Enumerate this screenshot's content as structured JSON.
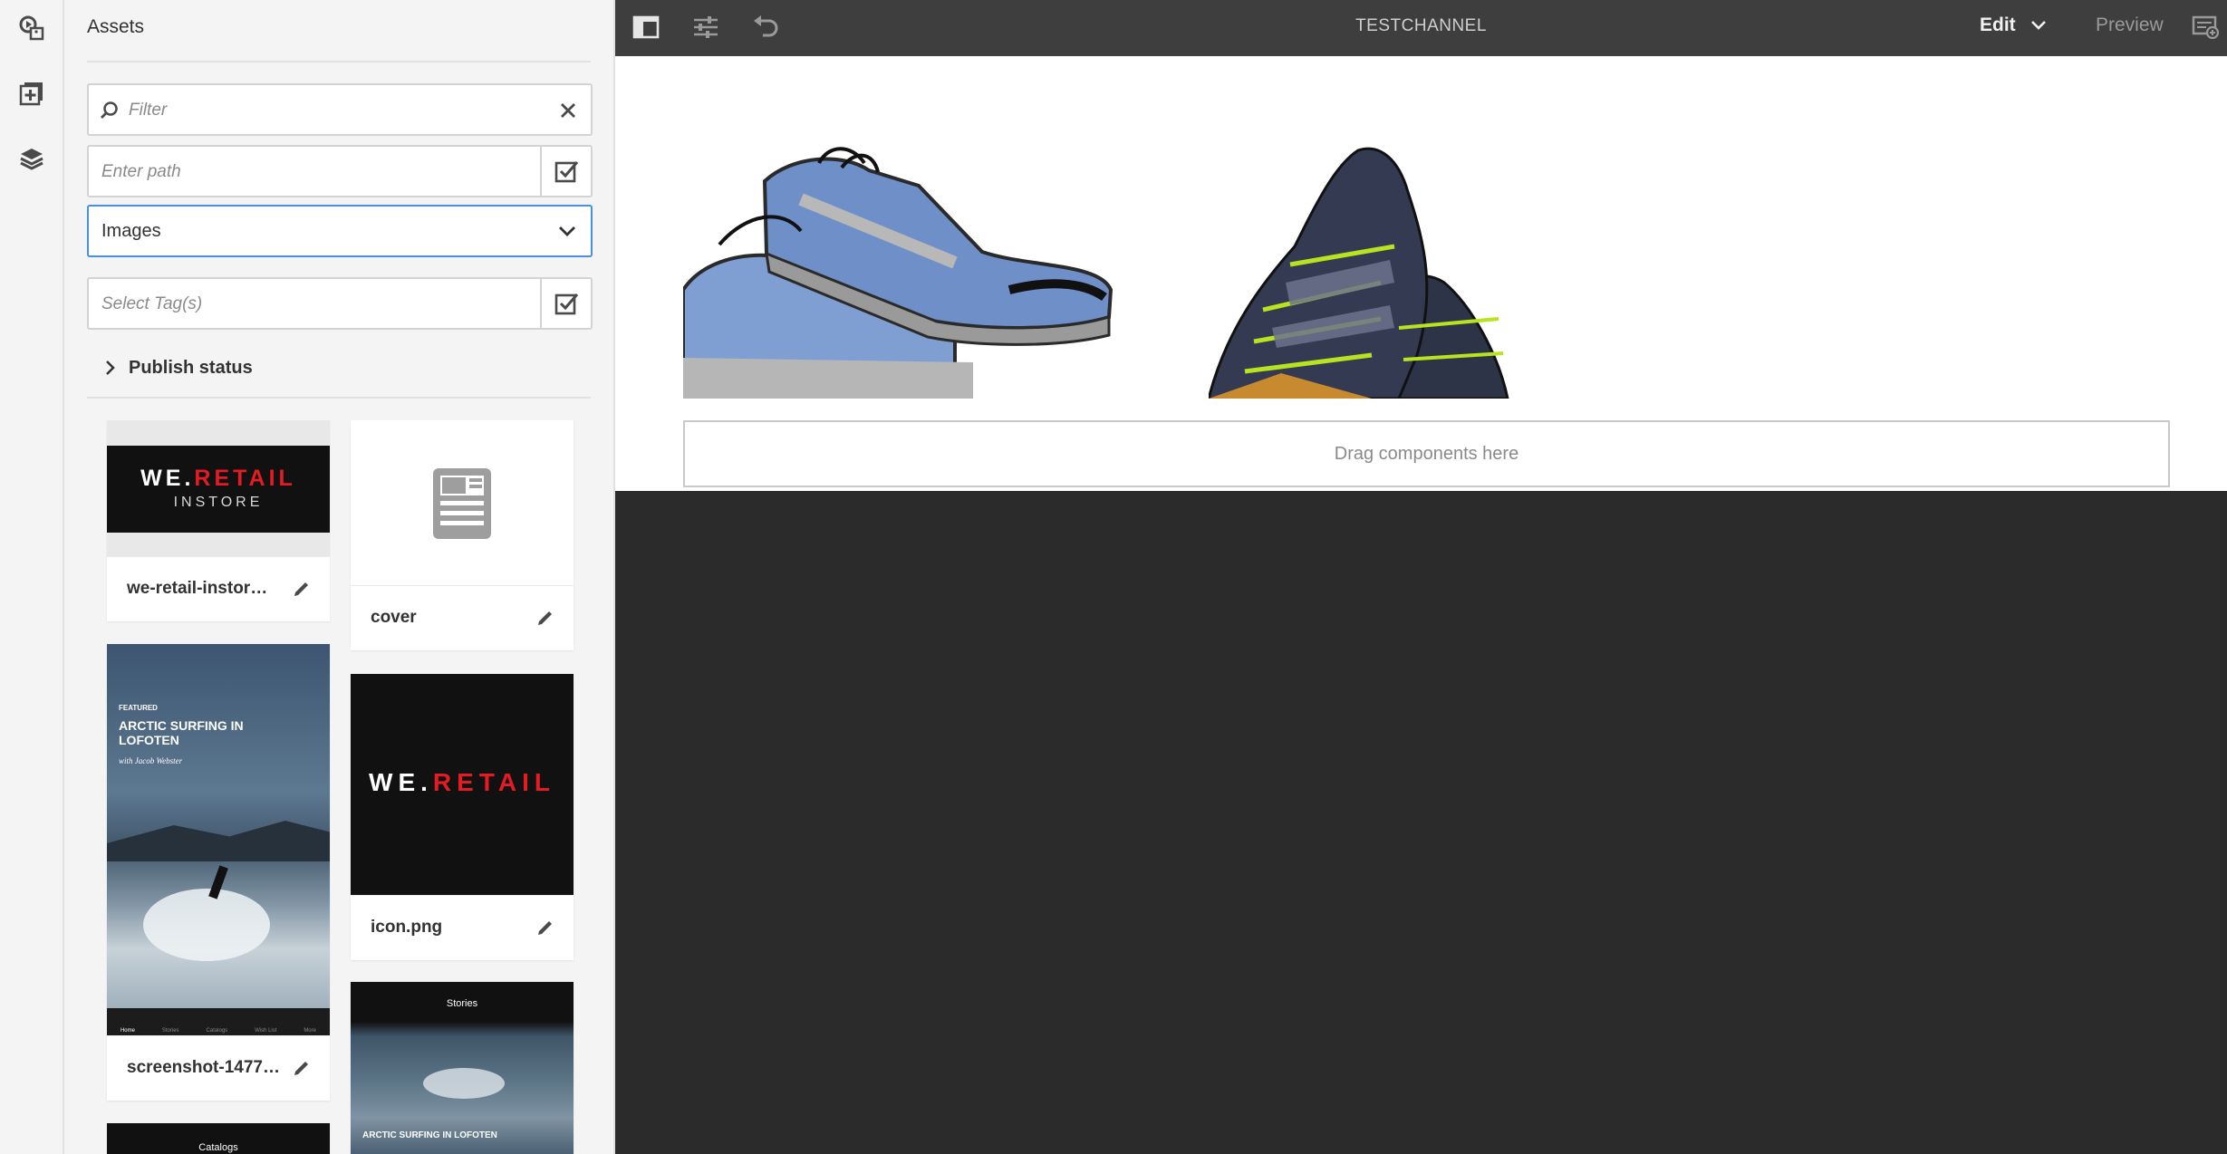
{
  "rail": {
    "icons": [
      "assets-icon",
      "components-icon",
      "content-tree-icon"
    ]
  },
  "panel": {
    "title": "Assets",
    "filter_placeholder": "Filter",
    "path_placeholder": "Enter path",
    "type_select_value": "Images",
    "tags_placeholder": "Select Tag(s)",
    "publish_status_label": "Publish status"
  },
  "assets": [
    {
      "name": "we-retail-instor…",
      "thumb_line1_a": "WE.",
      "thumb_line1_b": "RETAIL",
      "thumb_line2": "INSTORE"
    },
    {
      "name": "cover"
    },
    {
      "name": "screenshot-1477…",
      "thumb_featured": "FEATURED",
      "thumb_title": "ARCTIC SURFING IN LOFOTEN",
      "thumb_author": "with Jacob Webster",
      "thumb_nav": [
        "Home",
        "Stories",
        "Catalogs",
        "Wish List",
        "More"
      ]
    },
    {
      "name": "icon.png",
      "thumb_a": "WE.",
      "thumb_b": "RETAIL"
    },
    {
      "thumb_header": "Stories",
      "thumb_caption": "ARCTIC SURFING IN LOFOTEN"
    },
    {
      "thumb_header": "Catalogs"
    }
  ],
  "topbar": {
    "title": "TESTCHANNEL",
    "mode": "Edit",
    "preview": "Preview"
  },
  "canvas": {
    "dropzone_text": "Drag components here"
  },
  "colors": {
    "accent_red": "#e31b23",
    "select_focus": "#4b8fe2",
    "shoe_blue": "#7f9fd3",
    "shoe_lime": "#b7e41f"
  }
}
